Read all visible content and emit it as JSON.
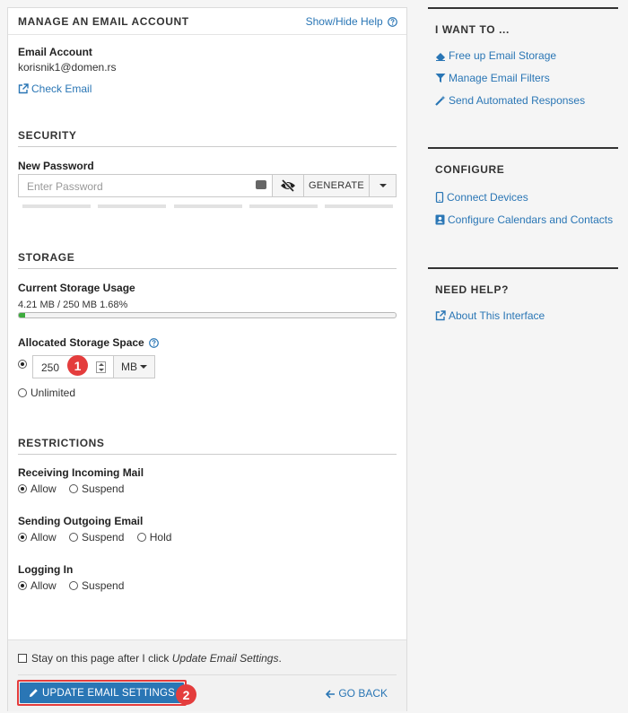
{
  "panel": {
    "title": "MANAGE AN EMAIL ACCOUNT",
    "help_link": "Show/Hide Help"
  },
  "account": {
    "label": "Email Account",
    "value": "korisnik1@domen.rs",
    "check_email": "Check Email"
  },
  "security": {
    "title": "SECURITY",
    "new_password_label": "New Password",
    "password_placeholder": "Enter Password",
    "generate_label": "GENERATE"
  },
  "storage": {
    "title": "STORAGE",
    "current_usage_label": "Current Storage Usage",
    "current_usage_value": "4.21 MB / 250 MB 1.68%",
    "usage_fraction": 0.0168,
    "allocated_label": "Allocated Storage Space",
    "quota_value": "250",
    "unit": "MB",
    "unlimited_label": "Unlimited"
  },
  "restrictions": {
    "title": "RESTRICTIONS",
    "receiving": {
      "label": "Receiving Incoming Mail",
      "options": [
        "Allow",
        "Suspend"
      ],
      "selected": "Allow"
    },
    "sending": {
      "label": "Sending Outgoing Email",
      "options": [
        "Allow",
        "Suspend",
        "Hold"
      ],
      "selected": "Allow"
    },
    "login": {
      "label": "Logging In",
      "options": [
        "Allow",
        "Suspend"
      ],
      "selected": "Allow"
    }
  },
  "footer": {
    "stay_prefix": "Stay on this page after I click ",
    "stay_emphasis": "Update Email Settings",
    "stay_suffix": ".",
    "update_button": "UPDATE EMAIL SETTINGS",
    "go_back": "GO BACK"
  },
  "badges": {
    "one": "1",
    "two": "2"
  },
  "sidebar": {
    "want_to": {
      "title": "I WANT TO ...",
      "items": [
        "Free up Email Storage",
        "Manage Email Filters",
        "Send Automated Responses"
      ]
    },
    "configure": {
      "title": "CONFIGURE",
      "items": [
        "Connect Devices",
        "Configure Calendars and Contacts"
      ]
    },
    "need_help": {
      "title": "NEED HELP?",
      "items": [
        "About This Interface"
      ]
    }
  },
  "colors": {
    "link": "#2a76b5",
    "primary_button": "#2a76b5",
    "annotation_red": "#e43d3d",
    "progress_green": "#3cab3c"
  },
  "icons": {
    "check_email": "external-link-icon",
    "help": "question-circle-icon",
    "password_toggle": "eye-slash-icon",
    "free_storage": "eraser-icon",
    "filters": "filter-icon",
    "autoresponder": "magic-wand-icon",
    "devices": "mobile-icon",
    "calendars": "contact-card-icon",
    "about": "external-link-icon",
    "update": "pencil-icon",
    "go_back": "arrow-left-icon"
  }
}
